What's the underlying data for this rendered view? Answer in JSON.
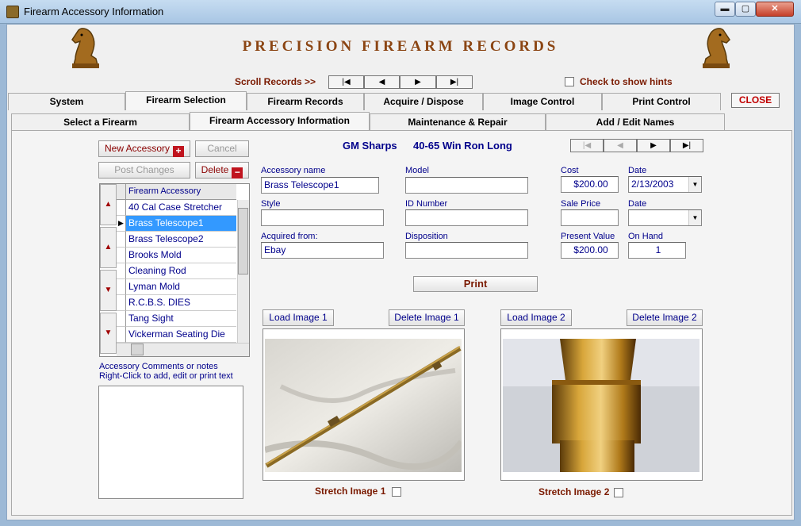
{
  "window": {
    "title": "Firearm Accessory Information",
    "min_glyph": "▬",
    "max_glyph": "▢",
    "close_glyph": "✕"
  },
  "banner": {
    "title": "PRECISION FIREARM RECORDS"
  },
  "scroll": {
    "label": "Scroll  Records >>",
    "first": "|◀",
    "prev": "◀",
    "next": "▶",
    "last": "▶|"
  },
  "hints": {
    "label": "Check to show hints"
  },
  "tabs_row1": [
    "System",
    "Firearm Selection",
    "Firearm Records",
    "Acquire / Dispose",
    "Image Control",
    "Print Control"
  ],
  "close_label": "CLOSE",
  "tabs_row2": [
    "Select a Firearm",
    "Firearm Accessory Information",
    "Maintenance & Repair",
    "Add / Edit Names"
  ],
  "actions": {
    "new": "New Accessory",
    "cancel": "Cancel",
    "post": "Post Changes",
    "delete": "Delete"
  },
  "firearm": {
    "name": "GM Sharps",
    "caliber": "40-65 Win Ron Long"
  },
  "record_nav": {
    "first": "|◀",
    "prev": "◀",
    "next": "▶",
    "last": "▶|"
  },
  "grid": {
    "header": "Firearm Accessory",
    "rows": [
      "40 Cal Case Stretcher",
      "Brass Telescope1",
      "Brass Telescope2",
      "Brooks Mold",
      "Cleaning Rod",
      "Lyman Mold",
      "R.C.B.S. DIES",
      "Tang Sight",
      "Vickerman Seating Die"
    ],
    "selected_index": 1
  },
  "form": {
    "accessory_name": {
      "label": "Accessory name",
      "value": "Brass Telescope1"
    },
    "model": {
      "label": "Model",
      "value": ""
    },
    "cost": {
      "label": "Cost",
      "value": "$200.00"
    },
    "date1": {
      "label": "Date",
      "value": "2/13/2003"
    },
    "style": {
      "label": "Style",
      "value": ""
    },
    "id_number": {
      "label": "ID Number",
      "value": ""
    },
    "sale_price": {
      "label": "Sale Price",
      "value": ""
    },
    "date2": {
      "label": "Date",
      "value": ""
    },
    "acquired_from": {
      "label": "Acquired from:",
      "value": "Ebay"
    },
    "disposition": {
      "label": "Disposition",
      "value": ""
    },
    "present_value": {
      "label": "Present Value",
      "value": "$200.00"
    },
    "on_hand": {
      "label": "On Hand",
      "value": "1"
    }
  },
  "print_label": "Print",
  "images": {
    "load1": "Load Image 1",
    "delete1": "Delete Image 1",
    "load2": "Load Image 2",
    "delete2": "Delete Image 2",
    "stretch1": "Stretch Image 1",
    "stretch2": "Stretch Image 2"
  },
  "notes": {
    "line1": "Accessory Comments or notes",
    "line2": "Right-Click to add, edit or print text"
  }
}
